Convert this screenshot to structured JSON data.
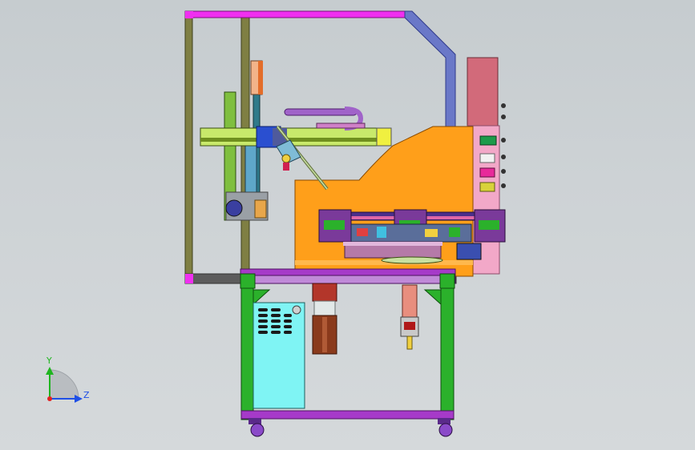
{
  "window": {
    "background": "#cdd2d5"
  },
  "triad": {
    "y_label": "Y",
    "z_label": "Z",
    "colors": {
      "y": "#1fb51f",
      "z": "#1e4fe6",
      "x": "#e32121"
    }
  },
  "palette": {
    "frame_outline": "#5e5f2c",
    "frame_fill": "#7f7f43",
    "magenta": "#f02ff0",
    "blue_frame": "#6a78c8",
    "orange": "#ff9f1a",
    "green": "#2bb12b",
    "purple": "#a63ac9",
    "cyan": "#7ff4f4",
    "rose": "#d26a7a",
    "brown": "#8a3a1c"
  }
}
